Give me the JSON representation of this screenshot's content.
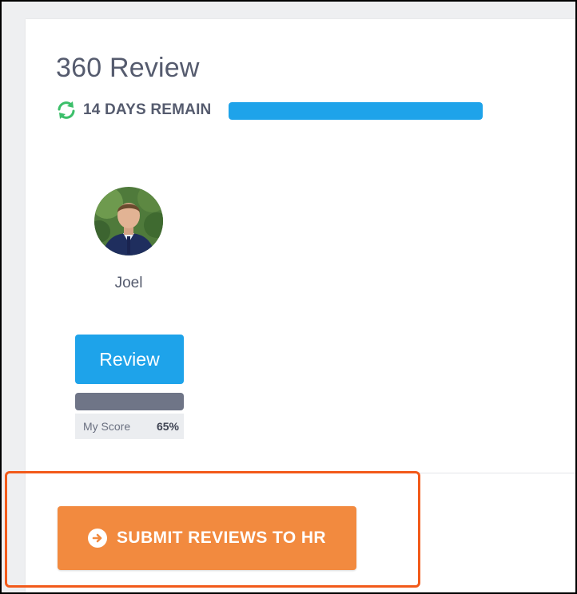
{
  "review": {
    "title": "360 Review",
    "days_remaining_label": "14 DAYS REMAIN",
    "progress_fraction": 1.0
  },
  "reviewee": {
    "name": "Joel",
    "review_button_label": "Review",
    "score_label": "My Score",
    "score_value": "65%"
  },
  "footer": {
    "submit_label": "SUBMIT REVIEWS TO HR"
  },
  "colors": {
    "accent_blue": "#1ea3ea",
    "refresh_green": "#3cbf6a",
    "submit_orange": "#f28a3f",
    "highlight_outline": "#f25a1a"
  },
  "icons": {
    "status": "refresh-icon",
    "submit": "arrow-circle-right-icon"
  }
}
